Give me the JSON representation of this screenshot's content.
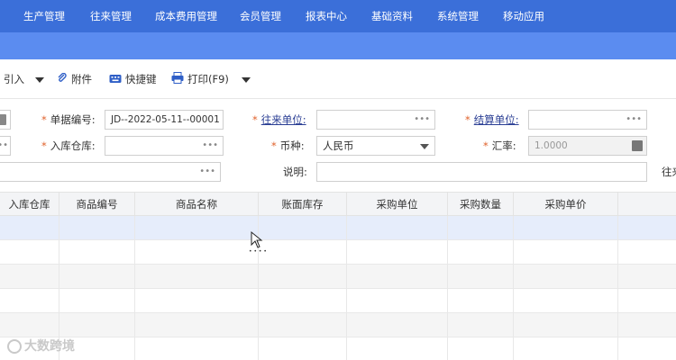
{
  "topnav": {
    "items": [
      "生产管理",
      "往来管理",
      "成本费用管理",
      "会员管理",
      "报表中心",
      "基础资料",
      "系统管理",
      "移动应用"
    ]
  },
  "toolbar": {
    "import_label": "引入",
    "attach_label": "附件",
    "shortcut_label": "快捷键",
    "print_label": "打印(F9)"
  },
  "form": {
    "doc_no_label": "单据编号:",
    "doc_no_value": "JD--2022-05-11--00001",
    "partner_label": "往来单位:",
    "partner_value": "",
    "settle_label": "结算单位:",
    "settle_value": "",
    "warehouse_label": "入库仓库:",
    "warehouse_value": "",
    "currency_label": "币种:",
    "currency_value": "人民币",
    "rate_label": "汇率:",
    "rate_value": "1.0000",
    "note_label": "说明:",
    "note_value": "",
    "cut_label": "往来"
  },
  "grid": {
    "headers": [
      "入库仓库",
      "商品编号",
      "商品名称",
      "账面库存",
      "采购单位",
      "采购数量",
      "采购单价"
    ]
  },
  "watermark": "大数跨境",
  "colors": {
    "nav": "#3b6fd9",
    "subbar": "#5b8cf0",
    "required": "#e0612b",
    "selected_row": "#e6edfb"
  }
}
